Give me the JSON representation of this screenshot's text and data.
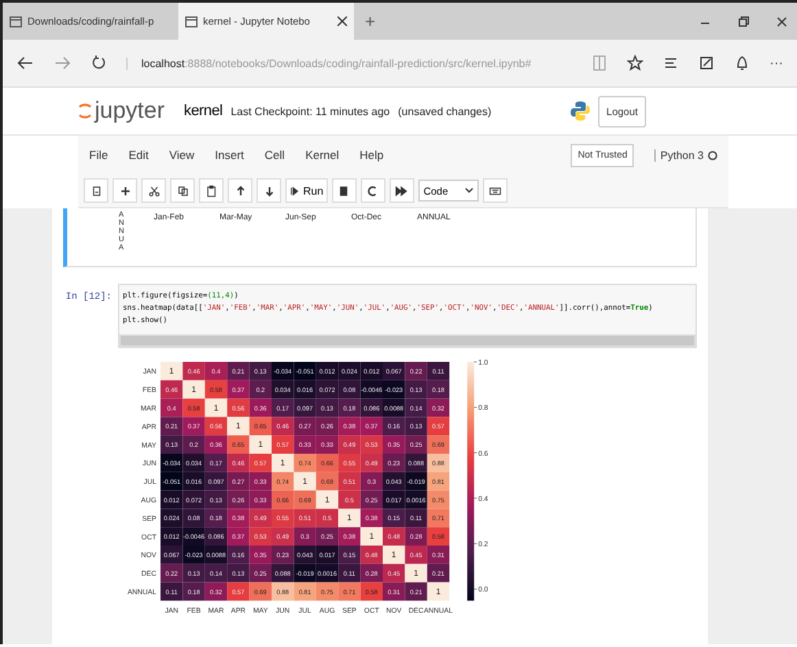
{
  "browser": {
    "tabs": [
      {
        "title": "Downloads/coding/rainfall-p",
        "selected": false
      },
      {
        "title": "kernel - Jupyter Notebo",
        "selected": true
      }
    ],
    "new_tab": "+",
    "url": {
      "host": "localhost",
      "path": ":8888/notebooks/Downloads/coding/rainfall-prediction/src/kernel.ipynb#"
    },
    "more": "···"
  },
  "header": {
    "logo_text": "jupyter",
    "notebook_name": "kernel",
    "checkpoint": "Last Checkpoint: 11 minutes ago",
    "autosave": "(unsaved changes)",
    "logout": "Logout"
  },
  "menu": {
    "items": [
      "File",
      "Edit",
      "View",
      "Insert",
      "Cell",
      "Kernel",
      "Help"
    ],
    "trust": "Not Trusted",
    "kernel": "Python 3"
  },
  "toolbar": {
    "run": "Run",
    "cell_type": "Code"
  },
  "previous_output": {
    "axis_label": "ANNUA",
    "labels": [
      "Jan-Feb",
      "Mar-May",
      "Jun-Sep",
      "Oct-Dec",
      "ANNUAL"
    ]
  },
  "cell": {
    "prompt": "In [12]:",
    "lines": [
      [
        {
          "kind": "plain",
          "text": "plt.figure(figsize="
        },
        {
          "kind": "number",
          "text": "(11,4)"
        },
        {
          "kind": "plain",
          "text": ")"
        }
      ],
      [
        {
          "kind": "plain",
          "text": "sns.heatmap(data[["
        },
        {
          "kind": "string",
          "text": "'JAN'"
        },
        {
          "kind": "plain",
          "text": ","
        },
        {
          "kind": "string",
          "text": "'FEB'"
        },
        {
          "kind": "plain",
          "text": ","
        },
        {
          "kind": "string",
          "text": "'MAR'"
        },
        {
          "kind": "plain",
          "text": ","
        },
        {
          "kind": "string",
          "text": "'APR'"
        },
        {
          "kind": "plain",
          "text": ","
        },
        {
          "kind": "string",
          "text": "'MAY'"
        },
        {
          "kind": "plain",
          "text": ","
        },
        {
          "kind": "string",
          "text": "'JUN'"
        },
        {
          "kind": "plain",
          "text": ","
        },
        {
          "kind": "string",
          "text": "'JUL'"
        },
        {
          "kind": "plain",
          "text": ","
        },
        {
          "kind": "string",
          "text": "'AUG'"
        },
        {
          "kind": "plain",
          "text": ","
        },
        {
          "kind": "string",
          "text": "'SEP'"
        },
        {
          "kind": "plain",
          "text": ","
        },
        {
          "kind": "string",
          "text": "'OCT'"
        },
        {
          "kind": "plain",
          "text": ","
        },
        {
          "kind": "string",
          "text": "'NOV'"
        },
        {
          "kind": "plain",
          "text": ","
        },
        {
          "kind": "string",
          "text": "'DEC'"
        },
        {
          "kind": "plain",
          "text": ","
        },
        {
          "kind": "string",
          "text": "'ANNUAL'"
        },
        {
          "kind": "plain",
          "text": "]].corr(),annot="
        },
        {
          "kind": "keyword",
          "text": "True"
        },
        {
          "kind": "plain",
          "text": ")"
        }
      ],
      [
        {
          "kind": "plain",
          "text": "plt.show()"
        }
      ]
    ]
  },
  "output": {
    "heatmap": {
      "column_labels": [
        "JAN",
        "FEB",
        "MAR",
        "APR",
        "MAY",
        "JUN",
        "JUL",
        "AUG",
        "SEP",
        "OCT",
        "NOV",
        "DEC",
        "ANNUAL"
      ],
      "colorbar_ticks": [
        "1.0",
        "0.8",
        "0.6",
        "0.4",
        "0.2",
        "0.0"
      ],
      "rows": [
        {
          "label": "JAN",
          "cells": [
            "1",
            "0.46",
            "0.4",
            "0.21",
            "0.13",
            "-0.034",
            "-0.051",
            "0.012",
            "0.024",
            "0.012",
            "0.067",
            "0.22",
            "0.11"
          ]
        },
        {
          "label": "FEB",
          "cells": [
            "0.46",
            "1",
            "0.58",
            "0.37",
            "0.2",
            "0.034",
            "0.016",
            "0.072",
            "0.08",
            "-0.0046",
            "-0.023",
            "0.13",
            "0.18"
          ]
        },
        {
          "label": "MAR",
          "cells": [
            "0.4",
            "0.58",
            "1",
            "0.56",
            "0.36",
            "0.17",
            "0.097",
            "0.13",
            "0.18",
            "0.086",
            "0.0088",
            "0.14",
            "0.32"
          ]
        },
        {
          "label": "APR",
          "cells": [
            "0.21",
            "0.37",
            "0.56",
            "1",
            "0.65",
            "0.46",
            "0.27",
            "0.26",
            "0.38",
            "0.37",
            "0.16",
            "0.13",
            "0.57"
          ]
        },
        {
          "label": "MAY",
          "cells": [
            "0.13",
            "0.2",
            "0.36",
            "0.65",
            "1",
            "0.57",
            "0.33",
            "0.33",
            "0.49",
            "0.53",
            "0.35",
            "0.25",
            "0.69"
          ]
        },
        {
          "label": "JUN",
          "cells": [
            "-0.034",
            "0.034",
            "0.17",
            "0.46",
            "0.57",
            "1",
            "0.74",
            "0.66",
            "0.55",
            "0.49",
            "0.23",
            "0.088",
            "0.88"
          ]
        },
        {
          "label": "JUL",
          "cells": [
            "-0.051",
            "0.016",
            "0.097",
            "0.27",
            "0.33",
            "0.74",
            "1",
            "0.69",
            "0.51",
            "0.3",
            "0.043",
            "-0.019",
            "0.81"
          ]
        },
        {
          "label": "AUG",
          "cells": [
            "0.012",
            "0.072",
            "0.13",
            "0.26",
            "0.33",
            "0.66",
            "0.69",
            "1",
            "0.5",
            "0.25",
            "0.017",
            "0.0016",
            "0.75"
          ]
        },
        {
          "label": "SEP",
          "cells": [
            "0.024",
            "0.08",
            "0.18",
            "0.38",
            "0.49",
            "0.55",
            "0.51",
            "0.5",
            "1",
            "0.38",
            "0.15",
            "0.11",
            "0.71"
          ]
        },
        {
          "label": "OCT",
          "cells": [
            "0.012",
            "-0.0046",
            "0.086",
            "0.37",
            "0.53",
            "0.49",
            "0.3",
            "0.25",
            "0.38",
            "1",
            "0.48",
            "0.28",
            "0.58"
          ]
        },
        {
          "label": "NOV",
          "cells": [
            "0.067",
            "-0.023",
            "0.0088",
            "0.16",
            "0.35",
            "0.23",
            "0.043",
            "0.017",
            "0.15",
            "0.48",
            "1",
            "0.45",
            "0.31"
          ]
        },
        {
          "label": "DEC",
          "cells": [
            "0.22",
            "0.13",
            "0.14",
            "0.13",
            "0.25",
            "0.088",
            "-0.019",
            "0.0016",
            "0.11",
            "0.28",
            "0.45",
            "1",
            "0.21"
          ]
        },
        {
          "label": "ANNUAL",
          "cells": [
            "0.11",
            "0.18",
            "0.32",
            "0.57",
            "0.69",
            "0.88",
            "0.81",
            "0.75",
            "0.71",
            "0.58",
            "0.31",
            "0.21",
            "1"
          ]
        }
      ]
    }
  }
}
